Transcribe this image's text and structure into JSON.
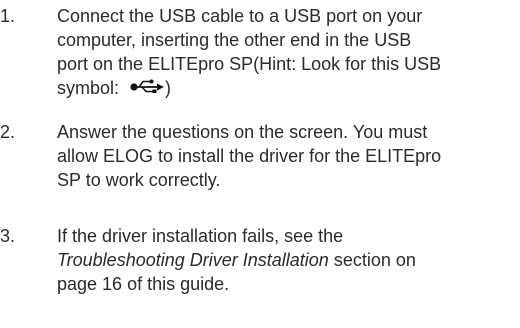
{
  "steps": [
    {
      "number": "1.",
      "lines": [
        "Connect the USB cable to a USB port on your",
        "computer, inserting the other end in the USB",
        "port on the ELITEpro SP(Hint: Look for this USB"
      ],
      "last_line_before_icon": "symbol: ",
      "last_line_after_icon": ")",
      "icon": "usb-symbol-icon"
    },
    {
      "number": "2.",
      "lines": [
        "Answer the questions on the screen. You must",
        "allow ELOG to install the driver for the ELITEpro",
        "SP to work correctly."
      ]
    },
    {
      "number": "3.",
      "lines": [
        "If the driver installation fails, see the"
      ],
      "italic_text": "Troubleshooting Driver Installation",
      "after_italic": " section on",
      "last_line": "page 16 of this guide."
    }
  ]
}
